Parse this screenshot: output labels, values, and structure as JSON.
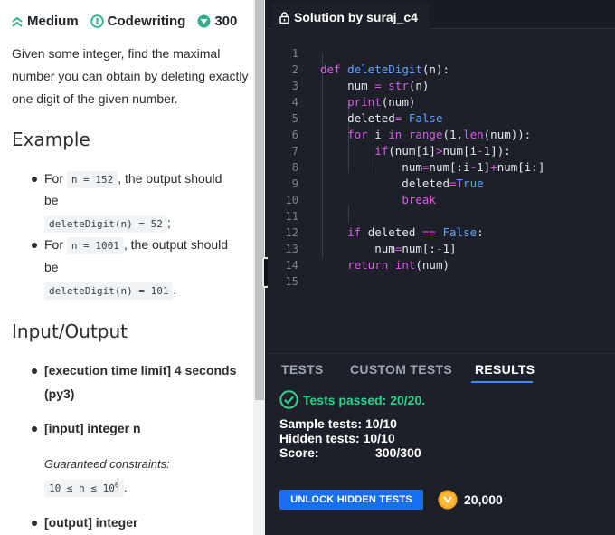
{
  "meta": {
    "difficulty": "Medium",
    "category": "Codewriting",
    "points": "300",
    "colors": {
      "difficulty": "#2fb08a",
      "category": "#2fb08a",
      "points": "#2fb08a"
    }
  },
  "description": "Given some integer, find the maximal number you can obtain by deleting exactly one digit of the given number.",
  "example": {
    "title": "Example",
    "items": [
      {
        "prefix": "For",
        "input_code": "n = 152",
        "suffix": ", the output should",
        "line2": "be",
        "output_code": "deleteDigit(n) = 52",
        "end": ";"
      },
      {
        "prefix": "For",
        "input_code": "n = 1001",
        "suffix": ", the output should",
        "line2": "be",
        "output_code": "deleteDigit(n) = 101",
        "end": "."
      }
    ]
  },
  "io": {
    "title": "Input/Output",
    "execution": {
      "label": "[execution time limit]",
      "value": " 4 seconds",
      "line2": "(py3)"
    },
    "input": {
      "label": "[input]",
      "value": " integer n"
    },
    "constraints_label": "Guaranteed constraints:",
    "constraint_code_main": "10 ≤ n ≤ 10",
    "constraint_code_exp": "6",
    "constraint_end": ".",
    "output": {
      "label": "[output]",
      "value": " integer"
    }
  },
  "editor": {
    "tab_title": "Solution by suraj_c4",
    "line_numbers": [
      "1",
      "2",
      "3",
      "4",
      "5",
      "6",
      "7",
      "8",
      "9",
      "10",
      "11",
      "12",
      "13",
      "14",
      "15"
    ]
  },
  "results": {
    "tabs": [
      "TESTS",
      "CUSTOM TESTS",
      "RESULTS"
    ],
    "active_tab": "RESULTS",
    "passed": "Tests passed: 20/20.",
    "sample_label": "Sample tests:",
    "sample_value": "10/10",
    "hidden_label": "Hidden tests:",
    "hidden_value": "10/10",
    "score_label": "Score:",
    "score_value": "300/300",
    "unlock_button": "UNLOCK HIDDEN TESTS",
    "coins": "20,000",
    "colors": {
      "passed": "#2fd08b",
      "button": "#1a6ef5",
      "coin": "#f7a823"
    }
  }
}
